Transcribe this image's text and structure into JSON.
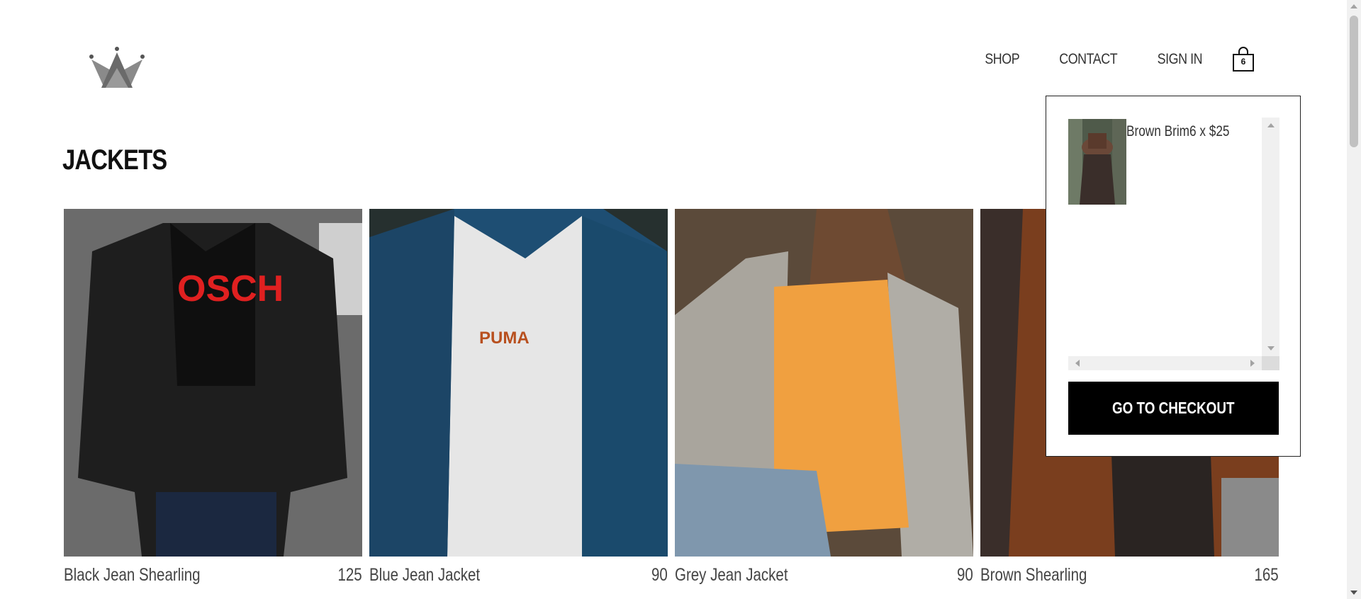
{
  "header": {
    "logo": "crown-logo",
    "nav": {
      "shop": "SHOP",
      "contact": "CONTACT",
      "sign_in": "SIGN IN"
    },
    "cart_count": "6"
  },
  "page": {
    "title": "JACKETS"
  },
  "products": [
    {
      "name": "Black Jean Shearling",
      "price": "125"
    },
    {
      "name": "Blue Jean Jacket",
      "price": "90"
    },
    {
      "name": "Grey Jean Jacket",
      "price": "90"
    },
    {
      "name": "Brown Shearling",
      "price": "165"
    }
  ],
  "cart_dropdown": {
    "items": [
      {
        "text": "Brown Brim6 x $25"
      }
    ],
    "checkout_label": "GO TO CHECKOUT"
  },
  "colors": {
    "text": "#333333",
    "button_bg": "#000000",
    "button_text": "#ffffff",
    "border": "#222222"
  }
}
